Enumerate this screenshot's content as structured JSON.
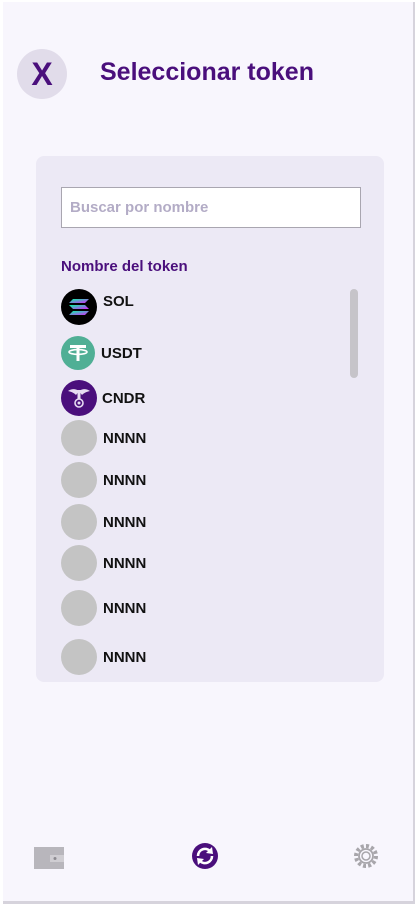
{
  "header": {
    "close_label": "X",
    "title": "Seleccionar token"
  },
  "search": {
    "placeholder": "Buscar por nombre"
  },
  "list": {
    "header": "Nombre del token",
    "tokens": [
      {
        "name": "SOL",
        "icon": "solana-logo-icon"
      },
      {
        "name": "USDT",
        "icon": "tether-logo-icon"
      },
      {
        "name": "CNDR",
        "icon": "cndr-logo-icon"
      },
      {
        "name": "NNNN",
        "icon": "placeholder-token-icon"
      },
      {
        "name": "NNNN",
        "icon": "placeholder-token-icon"
      },
      {
        "name": "NNNN",
        "icon": "placeholder-token-icon"
      },
      {
        "name": "NNNN",
        "icon": "placeholder-token-icon"
      },
      {
        "name": "NNNN",
        "icon": "placeholder-token-icon"
      },
      {
        "name": "NNNN",
        "icon": "placeholder-token-icon"
      }
    ]
  },
  "bottom_nav": {
    "items": [
      {
        "icon": "wallet-icon"
      },
      {
        "icon": "swap-icon",
        "active": true
      },
      {
        "icon": "settings-gear-icon"
      }
    ]
  },
  "colors": {
    "brand": "#4a0f7c",
    "background": "#f8f6fd",
    "card": "#ece9f5",
    "usdt": "#50af95",
    "placeholder": "#c4c4c4"
  }
}
